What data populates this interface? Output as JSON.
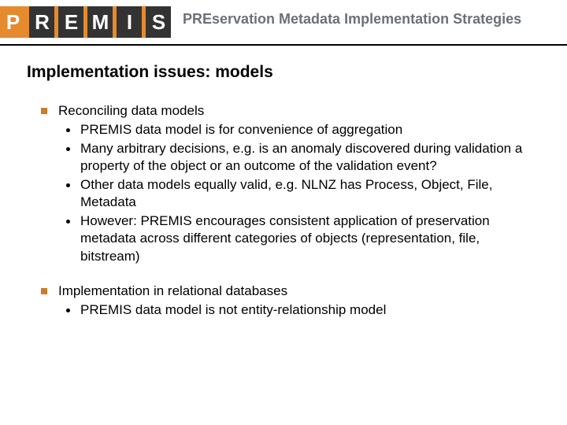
{
  "header": {
    "logo_letters": [
      "P",
      "R",
      "E",
      "M",
      "I",
      "S"
    ],
    "tagline_pre": "PRE",
    "tagline_rest": "servation Metadata Implementation Strategies"
  },
  "slide": {
    "title": "Implementation issues: models",
    "bullets": [
      {
        "text": "Reconciling data models",
        "sub": [
          "PREMIS data model is for convenience of aggregation",
          "Many arbitrary decisions, e.g. is an anomaly discovered during validation a property of the object or an outcome of the validation event?",
          "Other data models equally valid, e.g. NLNZ has Process, Object, File, Metadata",
          "However: PREMIS encourages consistent application of preservation metadata across different categories of objects (representation, file, bitstream)"
        ]
      },
      {
        "text": "Implementation in relational databases",
        "sub": [
          "PREMIS data model is not entity-relationship model"
        ]
      }
    ]
  }
}
